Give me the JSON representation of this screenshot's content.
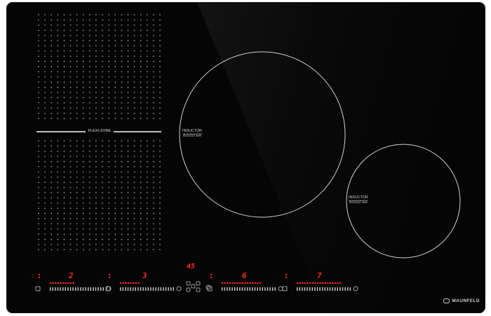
{
  "flexi_zone": {
    "label": "FLEXI-ZONE"
  },
  "zones": [
    {
      "label_top": "INDUCTOR",
      "label_bottom": "BOOSTER"
    },
    {
      "label_top": "INDUCTOR",
      "label_bottom": "BOOSTER"
    }
  ],
  "controls": [
    {
      "power_level": "2"
    },
    {
      "power_level": "3"
    },
    {
      "timer": "45"
    },
    {
      "power_level": "6"
    },
    {
      "power_level": "7"
    }
  ],
  "brand": {
    "name": "MAUNFELD"
  },
  "colors": {
    "glass": "#050505",
    "display": "#ff2a1a",
    "print": "#d8d8d8"
  }
}
